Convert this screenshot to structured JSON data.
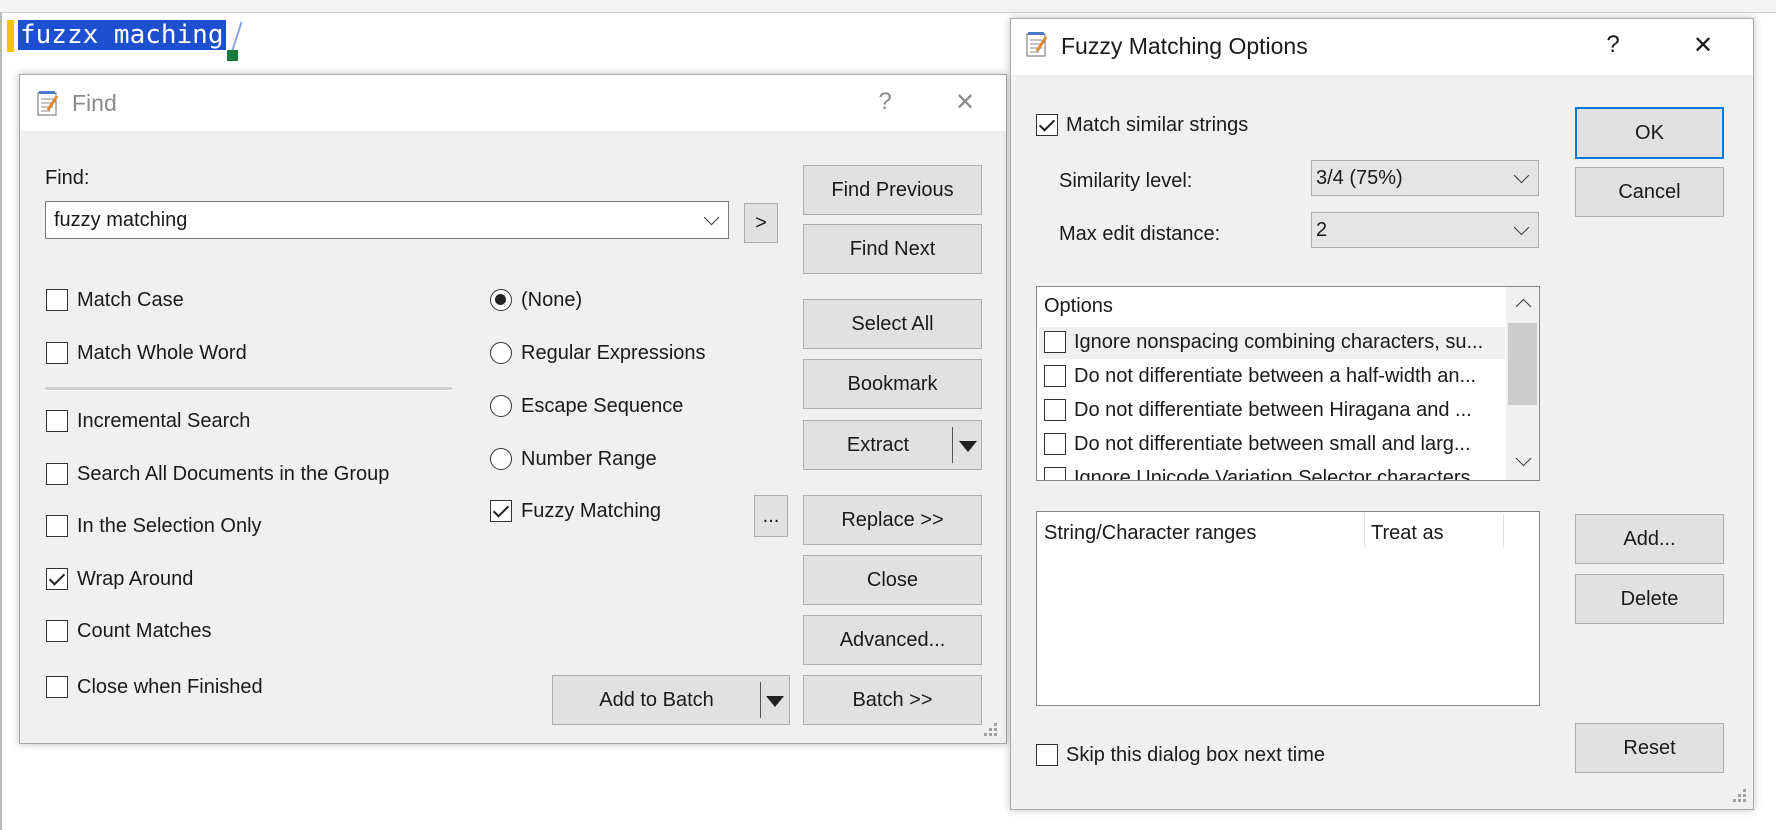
{
  "editor": {
    "text": "fuzzx maching"
  },
  "find_dialog": {
    "title": "Find",
    "help": "?",
    "close": "✕",
    "find_label": "Find:",
    "find_value": "fuzzy matching",
    "history_button": ">",
    "checkboxes": [
      {
        "label": "Match Case",
        "checked": false
      },
      {
        "label": "Match Whole Word",
        "checked": false
      },
      {
        "label": "Incremental Search",
        "checked": false
      },
      {
        "label": "Search All Documents in the Group",
        "checked": false
      },
      {
        "label": "In the Selection Only",
        "checked": false
      },
      {
        "label": "Wrap Around",
        "checked": true
      },
      {
        "label": "Count Matches",
        "checked": false
      },
      {
        "label": "Close when Finished",
        "checked": false
      }
    ],
    "radios": [
      {
        "label": "(None)",
        "checked": true
      },
      {
        "label": "Regular Expressions",
        "checked": false
      },
      {
        "label": "Escape Sequence",
        "checked": false
      },
      {
        "label": "Number Range",
        "checked": false
      }
    ],
    "fuzzy": {
      "label": "Fuzzy Matching",
      "checked": true,
      "options_button": "..."
    },
    "buttons": {
      "find_previous": "Find Previous",
      "find_next": "Find Next",
      "select_all": "Select All",
      "bookmark": "Bookmark",
      "extract": "Extract",
      "replace": "Replace >>",
      "close": "Close",
      "advanced": "Advanced...",
      "batch": "Batch >>",
      "add_to_batch": "Add to Batch"
    }
  },
  "fuzzy_dialog": {
    "title": "Fuzzy Matching Options",
    "help": "?",
    "close": "✕",
    "match_similar": {
      "label": "Match similar strings",
      "checked": true
    },
    "similarity_label": "Similarity level:",
    "similarity_value": "3/4 (75%)",
    "max_edit_label": "Max edit distance:",
    "max_edit_value": "2",
    "options_header": "Options",
    "options": [
      "Ignore nonspacing combining characters, su...",
      "Do not differentiate between a half-width an...",
      "Do not differentiate between Hiragana and ...",
      "Do not differentiate between small and larg...",
      "Ignore Unicode Variation Selector characters"
    ],
    "ranges_columns": [
      "String/Character ranges",
      "Treat as"
    ],
    "skip": {
      "label": "Skip this dialog box next time",
      "checked": false
    },
    "buttons": {
      "ok": "OK",
      "cancel": "Cancel",
      "add": "Add...",
      "delete": "Delete",
      "reset": "Reset"
    }
  }
}
